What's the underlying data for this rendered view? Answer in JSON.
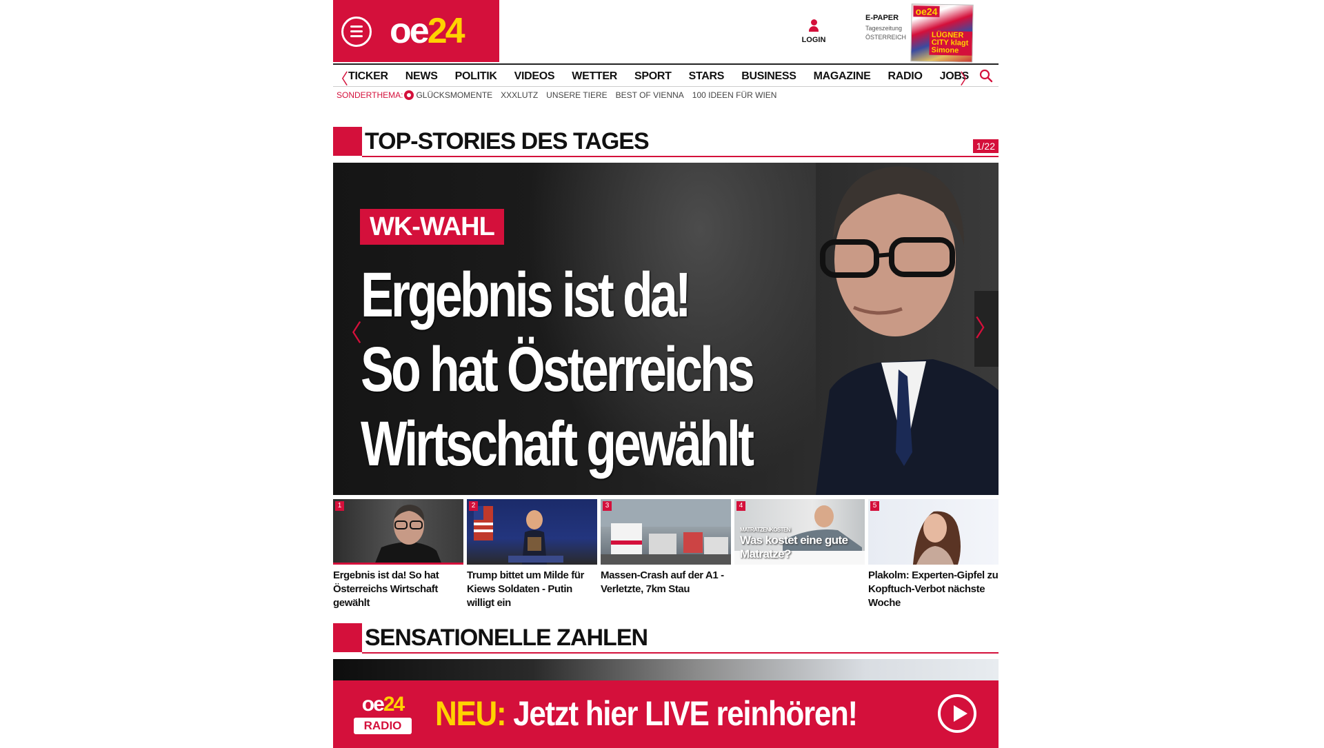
{
  "header": {
    "logo_main": "oe",
    "logo_accent": "24",
    "login_label": "LOGIN",
    "epaper_title": "E-PAPER",
    "epaper_sub1": "Tageszeitung",
    "epaper_sub2": "ÖSTERREICH",
    "epaper_cover_badge": "oe24",
    "epaper_cover_headline": "LÜGNER CITY klagt Simone"
  },
  "nav": {
    "prev_arrow": "〈",
    "next_arrow": "〉",
    "items": [
      "TICKER",
      "NEWS",
      "POLITIK",
      "VIDEOS",
      "WETTER",
      "SPORT",
      "STARS",
      "BUSINESS",
      "MAGAZINE",
      "RADIO",
      "JOBS"
    ]
  },
  "subnav": {
    "label": "SONDERTHEMA:",
    "items": [
      "GLÜCKSMOMENTE",
      "XXXLUTZ",
      "UNSERE TIERE",
      "BEST OF VIENNA",
      "100 IDEEN FÜR WIEN"
    ]
  },
  "top_stories": {
    "title": "TOP-STORIES DES TAGES",
    "counter": "1/22",
    "hero_tag": "WK-WAHL",
    "hero_line1": "Ergebnis ist da!",
    "hero_line2": "So hat Österreichs",
    "hero_line3": "Wirtschaft gewählt",
    "prev_arrow": "〈",
    "next_arrow": "〉",
    "thumbs": [
      {
        "num": "1",
        "caption": "Ergebnis ist da! So hat Österreichs Wirtschaft gewählt"
      },
      {
        "num": "2",
        "caption": "Trump bittet um Milde für Kiews Soldaten - Putin willigt ein"
      },
      {
        "num": "3",
        "caption": "Massen-Crash auf der A1 - Verletzte, 7km Stau"
      },
      {
        "num": "4",
        "caption": "",
        "overlay": "Was kostet eine gute Matratze?",
        "overlay_kicker": "MATRATZENKOSTEN"
      },
      {
        "num": "5",
        "caption": "Plakolm: Experten-Gipfel zu Kopftuch-Verbot nächste Woche"
      }
    ]
  },
  "sensationelle": {
    "title": "SENSATIONELLE ZAHLEN"
  },
  "radio_banner": {
    "logo_main": "oe",
    "logo_accent": "24",
    "logo_radio": "RADIO",
    "neu": "NEU:",
    "text": "Jetzt hier LIVE reinhören!"
  },
  "colors": {
    "brand_red": "#d4103b",
    "accent_yellow": "#ffd200"
  }
}
